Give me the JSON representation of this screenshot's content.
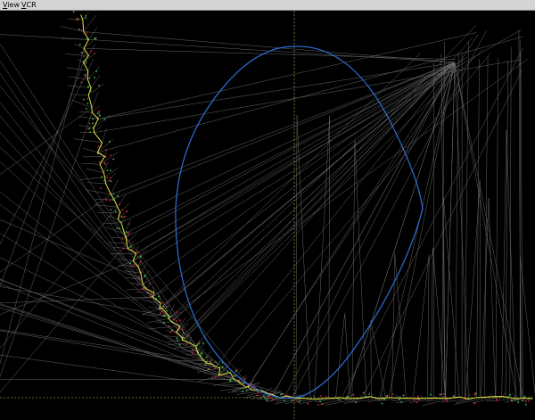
{
  "menubar": {
    "items": [
      {
        "mnemonic": "V",
        "rest": "iew"
      },
      {
        "mnemonic": "V",
        "rest": "CR"
      }
    ]
  },
  "colors": {
    "background": "#000000",
    "menubar": "#d4d4d4",
    "mesh": "#8c8c8c",
    "boundary": "#e2e24a",
    "axis": "#8a8a3a",
    "ellipse": "#2f6fd8",
    "points_red": "#c0283a",
    "points_green": "#3cb84a"
  }
}
